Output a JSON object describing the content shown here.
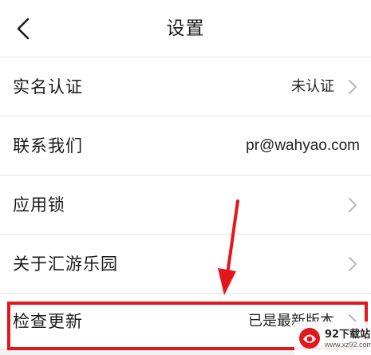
{
  "header": {
    "title": "设置",
    "back_icon": "chevron-left-icon"
  },
  "settings": {
    "items": [
      {
        "label": "实名认证",
        "value": "未认证",
        "icon": "chevron-right-icon"
      },
      {
        "label": "联系我们",
        "value": "pr@wahyao.com"
      },
      {
        "label": "应用锁",
        "value": "",
        "icon": "chevron-right-icon"
      },
      {
        "label": "关于汇游乐园",
        "value": "",
        "icon": "chevron-right-icon"
      },
      {
        "label": "检查更新",
        "value": "已是最新版本",
        "icon": "chevron-right-icon"
      }
    ]
  },
  "annotation": {
    "color": "#e3161b",
    "arrow_icon": "arrow-down-icon"
  },
  "watermark": {
    "title": "92下载站",
    "url": "www.xz92.com"
  }
}
